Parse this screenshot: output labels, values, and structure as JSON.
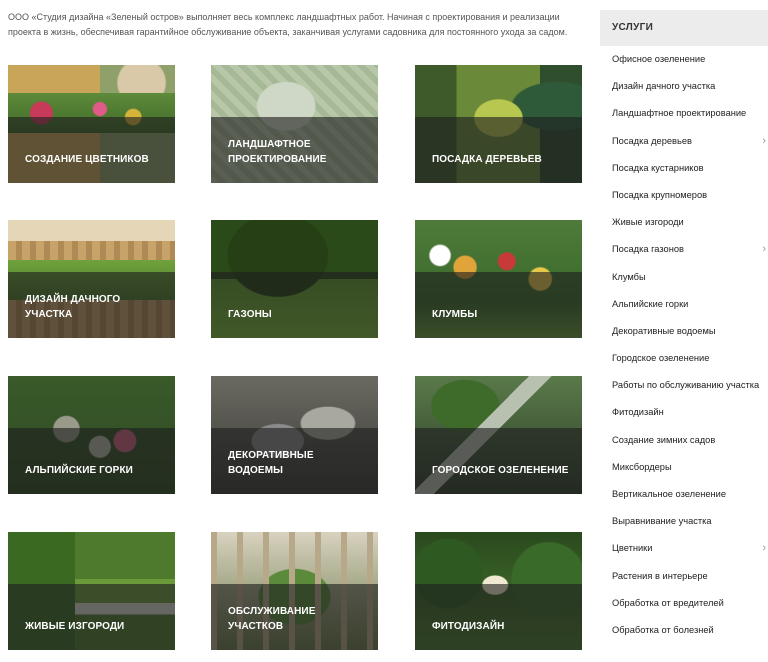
{
  "intro": "ООО «Студия дизайна «Зеленый остров» выполняет весь комплекс ландшафтных работ. Начиная с проектирования и реализации проекта в жизнь, обеспечивая гарантийное обслуживание объекта, заканчивая услугами садовника для постоянного ухода за садом.",
  "tiles": [
    "Создание цветников",
    "Ландшафтное проектирование",
    "Посадка деревьев",
    "Дизайн дачного участка",
    "Газоны",
    "Клумбы",
    "Альпийские горки",
    "Декоративные водоемы",
    "Городское озеленение",
    "Живые изгороди",
    "Обслуживание участков",
    "Фитодизайн"
  ],
  "sidebar": {
    "title": "Услуги",
    "items": [
      {
        "label": "Офисное озеленение",
        "has_sub": false
      },
      {
        "label": "Дизайн дачного участка",
        "has_sub": false
      },
      {
        "label": "Ландшафтное проектирование",
        "has_sub": false
      },
      {
        "label": "Посадка деревьев",
        "has_sub": true
      },
      {
        "label": "Посадка кустарников",
        "has_sub": false
      },
      {
        "label": "Посадка крупномеров",
        "has_sub": false
      },
      {
        "label": "Живые изгороди",
        "has_sub": false
      },
      {
        "label": "Посадка газонов",
        "has_sub": true
      },
      {
        "label": "Клумбы",
        "has_sub": false
      },
      {
        "label": "Альпийские горки",
        "has_sub": false
      },
      {
        "label": "Декоративные водоемы",
        "has_sub": false
      },
      {
        "label": "Городское озеленение",
        "has_sub": false
      },
      {
        "label": "Работы по обслуживанию участка",
        "has_sub": false
      },
      {
        "label": "Фитодизайн",
        "has_sub": false
      },
      {
        "label": "Создание зимних садов",
        "has_sub": false
      },
      {
        "label": "Миксбордеры",
        "has_sub": false
      },
      {
        "label": "Вертикальное озеленение",
        "has_sub": false
      },
      {
        "label": "Выравнивание участка",
        "has_sub": false
      },
      {
        "label": "Цветники",
        "has_sub": true
      },
      {
        "label": "Растения в интерьере",
        "has_sub": false
      },
      {
        "label": "Обработка от вредителей",
        "has_sub": false
      },
      {
        "label": "Обработка от болезней",
        "has_sub": false
      }
    ],
    "chevron_icon": "chevron-right-icon"
  }
}
